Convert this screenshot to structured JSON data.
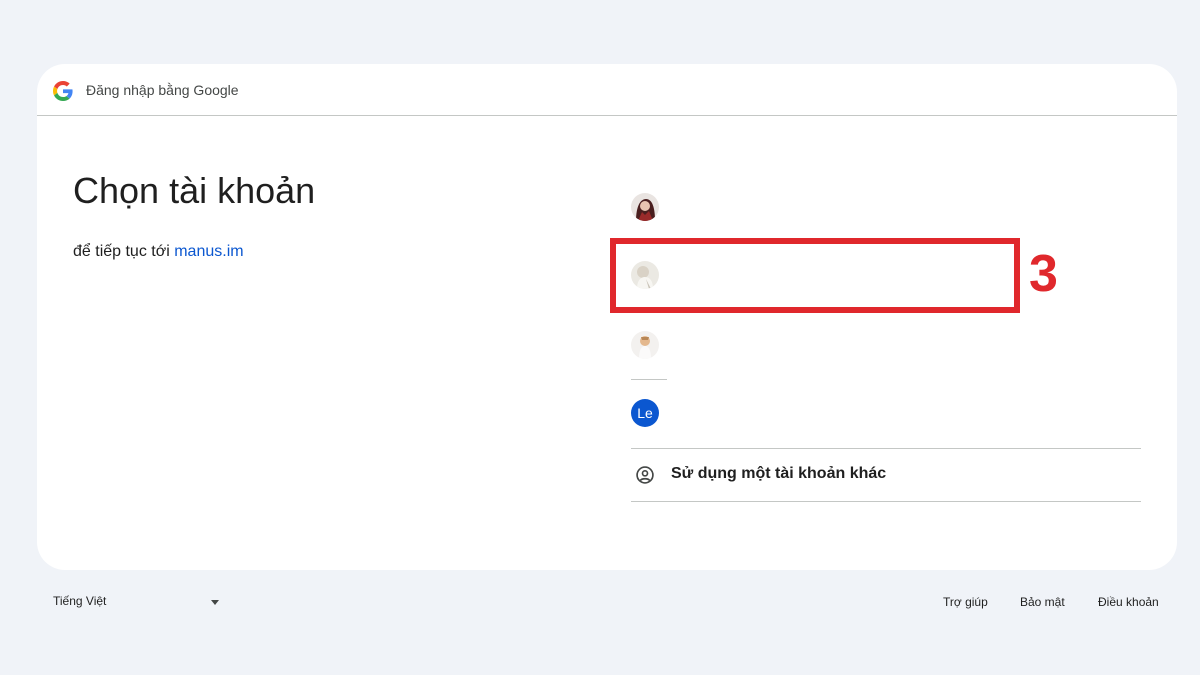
{
  "header": {
    "title": "Đăng nhập bằng Google",
    "logo_icon": "google-g-icon"
  },
  "main": {
    "title": "Chọn tài khoản",
    "subtitle_prefix": "để tiếp tục tới",
    "subtitle_link": "manus.im"
  },
  "accounts": [
    {
      "avatar": "photo",
      "label": ""
    },
    {
      "avatar": "photo",
      "label": ""
    },
    {
      "avatar": "photo",
      "label": ""
    },
    {
      "avatar": "letter",
      "letter": "Le",
      "color": "#0b57d0"
    }
  ],
  "other_account": {
    "icon": "account-circle-icon",
    "label": "Sử dụng một tài khoản khác"
  },
  "annotation": {
    "step": "3",
    "color": "#e0282c"
  },
  "footer": {
    "language": "Tiếng Việt",
    "links": [
      "Trợ giúp",
      "Bảo mật",
      "Điều khoản"
    ]
  },
  "colors": {
    "background": "#f0f3f8",
    "card": "#ffffff",
    "link": "#0b57d0",
    "accent_red": "#e0282c"
  }
}
